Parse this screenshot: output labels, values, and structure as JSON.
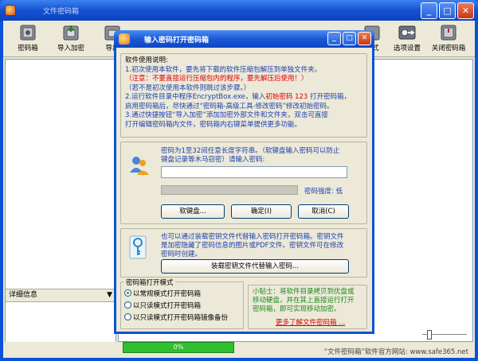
{
  "window": {
    "title": "文件密码箱"
  },
  "toolbar": {
    "items": [
      {
        "label": "密码箱",
        "icon": "safe-icon"
      },
      {
        "label": "导入加密",
        "icon": "import-encrypt-icon"
      },
      {
        "label": "导出",
        "icon": "export-icon"
      },
      {
        "label": "方式",
        "icon": "mode-icon"
      },
      {
        "label": "选项设置",
        "icon": "options-icon"
      },
      {
        "label": "关闭密码箱",
        "icon": "close-safe-icon"
      }
    ]
  },
  "left_pane": {
    "detail_header": "详细信息",
    "detail_arrow": "▼"
  },
  "statusbar": {
    "progress_text": "0%",
    "progress_value": 0,
    "site": "“文件密码箱”软件官方网站: www.safe365.net"
  },
  "dialog": {
    "title": "输入密码打开密码箱",
    "instructions": {
      "heading": "软件使用说明:",
      "line1": "1.初次使用本软件，要先将下载的软件压缩包解压到单独文件夹。",
      "line2": "（注意：不要直接运行压缩包内的程序，要先解压后使用！）",
      "line3": "（若不是初次使用本软件则跳过该步骤。）",
      "line4a": "2.运行软件目录中程序EncryptBox.exe，输入",
      "line4b": "初始密码 123",
      "line4c": "打开密码箱，",
      "line5": "启用密码箱后，尽快通过“密码箱-高级工具-修改密码”修改初始密码。",
      "line6": "3.通过快捷按钮“导入加密”添加加密外部文件和文件夹，双击可直接",
      "line7": "打开编辑密码箱内文件，密码箱内右键菜单提供更多功能。"
    },
    "password": {
      "hint_line1": "密码为1至32间任意长度字符串。（软键盘输入密码可以防止",
      "hint_line2": "键盘记录等木马窃密）请输入密码:",
      "input_value": "",
      "strength_label": "密码强度: 低",
      "strength_value": 0,
      "soft_keyboard": "软键盘...",
      "ok": "确定(I)",
      "cancel": "取消(C)"
    },
    "keyfile": {
      "line1": "也可以通过装载密钥文件代替输入密码打开密码箱。密钥文件",
      "line2": "是加密隐藏了密码信息的图片或PDF文件。密钥文件可在修改",
      "line3": "密码时创建。",
      "button": "装载密钥文件代替输入密码..."
    },
    "open_mode": {
      "title": "密码箱打开模式",
      "options": [
        {
          "label": "以常规模式打开密码箱",
          "selected": true
        },
        {
          "label": "以只读模式打开密码箱",
          "selected": false
        },
        {
          "label": "以只读模式打开密码箱镜像备份",
          "selected": false
        }
      ]
    },
    "tips": {
      "line1": "小贴士：将软件目录拷贝到优盘或",
      "line2": "移动硬盘，并在其上直接运行打开",
      "line3": "密码箱，即可实现移动加密。",
      "link": "更多了解文件密码箱 ..."
    }
  }
}
